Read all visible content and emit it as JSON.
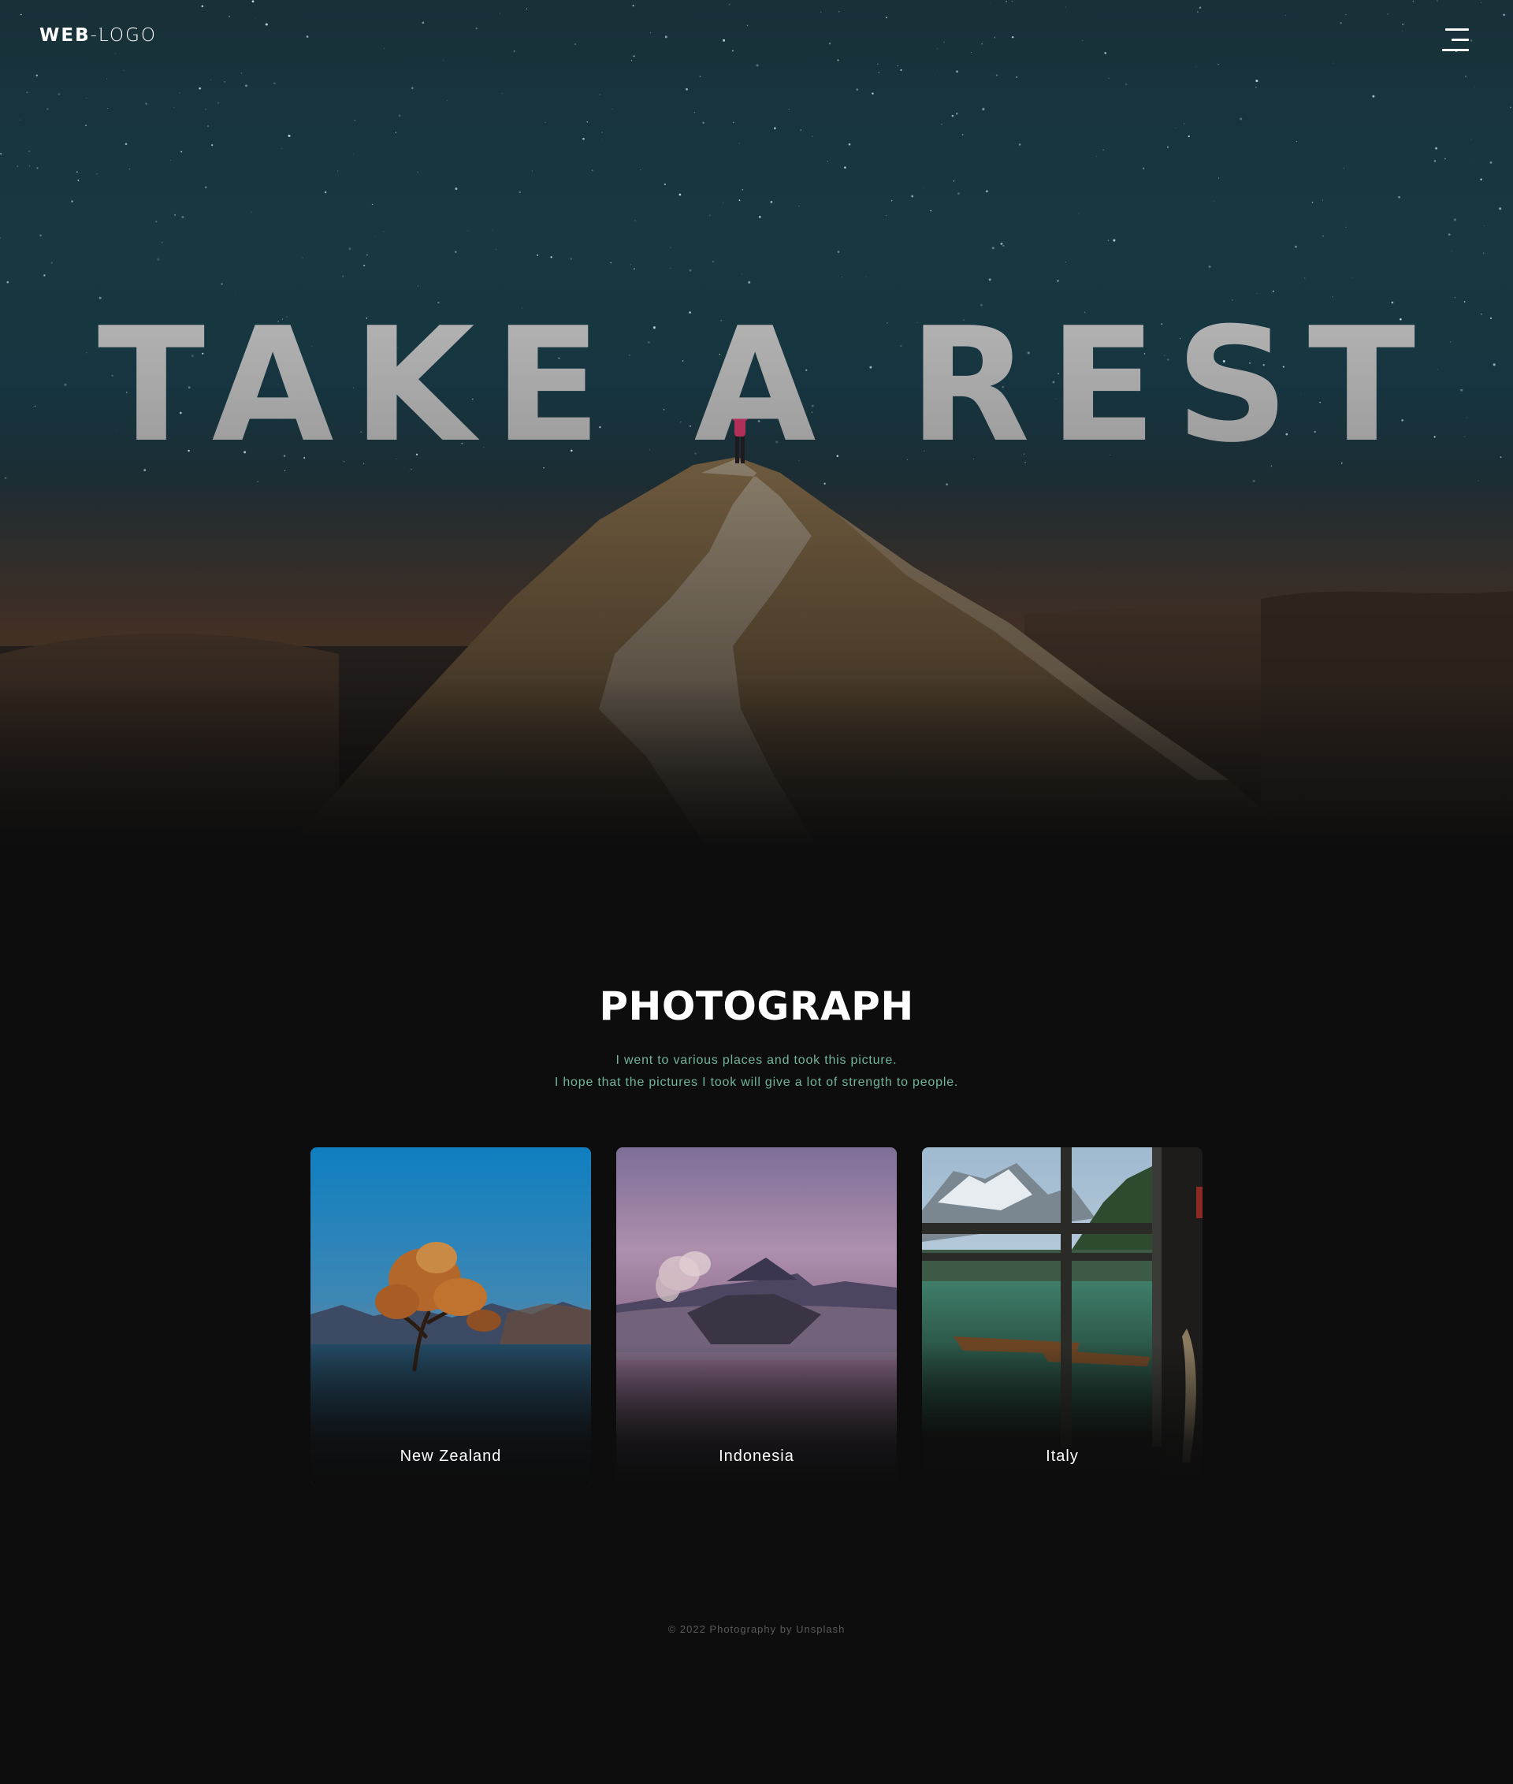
{
  "header": {
    "logo_bold": "WEB",
    "logo_light": "-LOGO",
    "menu_icon": "hamburger-menu-icon"
  },
  "hero": {
    "title": "TAKE A REST"
  },
  "gallery": {
    "title": "PHOTOGRAPH",
    "description_line1": "I went to various places and took this picture.",
    "description_line2": "I hope that the pictures I took will give a lot of strength to people.",
    "cards": [
      {
        "label": "New Zealand"
      },
      {
        "label": "Indonesia"
      },
      {
        "label": "Italy"
      }
    ]
  },
  "footer": {
    "text": "© 2022 Photography by Unsplash"
  },
  "colors": {
    "background": "#0d0d0d",
    "accent_text": "#70b59a",
    "title_text": "#ffffff"
  }
}
